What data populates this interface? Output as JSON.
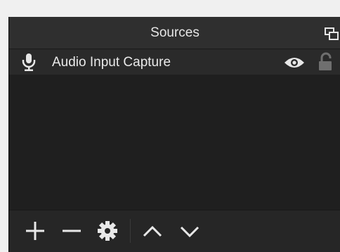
{
  "dock": {
    "title": "Sources",
    "undock_icon": "float-window-icon"
  },
  "sources": [
    {
      "name": "Audio Input Capture",
      "type_icon": "microphone-icon",
      "visible_icon": "eye-icon",
      "lock_icon": "lock-open-icon"
    }
  ],
  "toolbar": {
    "icons": [
      "plus-icon",
      "minus-icon",
      "gear-icon",
      "chevron-up-icon",
      "chevron-down-icon"
    ]
  },
  "colors": {
    "panel_bg": "#1e1e1e",
    "title_bg": "#2f2f2f",
    "row_bg": "#2a2a2a",
    "icon_fill": "#e8e8e8",
    "lock_fill": "#6f6f6f"
  }
}
